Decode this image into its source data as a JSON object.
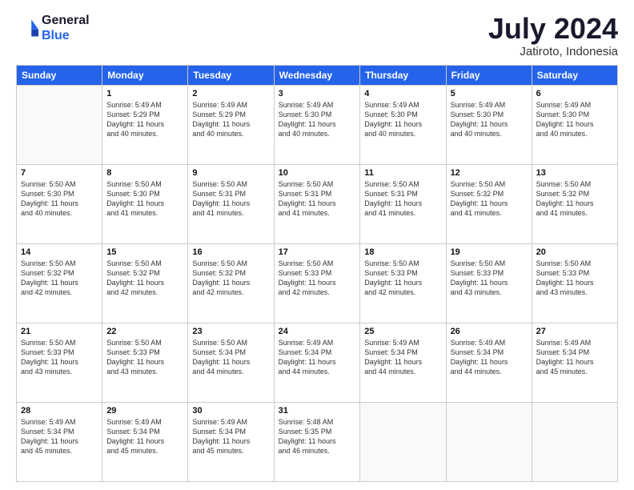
{
  "logo": {
    "text_general": "General",
    "text_blue": "Blue"
  },
  "title": "July 2024",
  "subtitle": "Jatiroto, Indonesia",
  "header_days": [
    "Sunday",
    "Monday",
    "Tuesday",
    "Wednesday",
    "Thursday",
    "Friday",
    "Saturday"
  ],
  "weeks": [
    [
      {
        "day": "",
        "info": ""
      },
      {
        "day": "1",
        "info": "Sunrise: 5:49 AM\nSunset: 5:29 PM\nDaylight: 11 hours\nand 40 minutes."
      },
      {
        "day": "2",
        "info": "Sunrise: 5:49 AM\nSunset: 5:29 PM\nDaylight: 11 hours\nand 40 minutes."
      },
      {
        "day": "3",
        "info": "Sunrise: 5:49 AM\nSunset: 5:30 PM\nDaylight: 11 hours\nand 40 minutes."
      },
      {
        "day": "4",
        "info": "Sunrise: 5:49 AM\nSunset: 5:30 PM\nDaylight: 11 hours\nand 40 minutes."
      },
      {
        "day": "5",
        "info": "Sunrise: 5:49 AM\nSunset: 5:30 PM\nDaylight: 11 hours\nand 40 minutes."
      },
      {
        "day": "6",
        "info": "Sunrise: 5:49 AM\nSunset: 5:30 PM\nDaylight: 11 hours\nand 40 minutes."
      }
    ],
    [
      {
        "day": "7",
        "info": "Sunrise: 5:50 AM\nSunset: 5:30 PM\nDaylight: 11 hours\nand 40 minutes."
      },
      {
        "day": "8",
        "info": "Sunrise: 5:50 AM\nSunset: 5:30 PM\nDaylight: 11 hours\nand 41 minutes."
      },
      {
        "day": "9",
        "info": "Sunrise: 5:50 AM\nSunset: 5:31 PM\nDaylight: 11 hours\nand 41 minutes."
      },
      {
        "day": "10",
        "info": "Sunrise: 5:50 AM\nSunset: 5:31 PM\nDaylight: 11 hours\nand 41 minutes."
      },
      {
        "day": "11",
        "info": "Sunrise: 5:50 AM\nSunset: 5:31 PM\nDaylight: 11 hours\nand 41 minutes."
      },
      {
        "day": "12",
        "info": "Sunrise: 5:50 AM\nSunset: 5:32 PM\nDaylight: 11 hours\nand 41 minutes."
      },
      {
        "day": "13",
        "info": "Sunrise: 5:50 AM\nSunset: 5:32 PM\nDaylight: 11 hours\nand 41 minutes."
      }
    ],
    [
      {
        "day": "14",
        "info": "Sunrise: 5:50 AM\nSunset: 5:32 PM\nDaylight: 11 hours\nand 42 minutes."
      },
      {
        "day": "15",
        "info": "Sunrise: 5:50 AM\nSunset: 5:32 PM\nDaylight: 11 hours\nand 42 minutes."
      },
      {
        "day": "16",
        "info": "Sunrise: 5:50 AM\nSunset: 5:32 PM\nDaylight: 11 hours\nand 42 minutes."
      },
      {
        "day": "17",
        "info": "Sunrise: 5:50 AM\nSunset: 5:33 PM\nDaylight: 11 hours\nand 42 minutes."
      },
      {
        "day": "18",
        "info": "Sunrise: 5:50 AM\nSunset: 5:33 PM\nDaylight: 11 hours\nand 42 minutes."
      },
      {
        "day": "19",
        "info": "Sunrise: 5:50 AM\nSunset: 5:33 PM\nDaylight: 11 hours\nand 43 minutes."
      },
      {
        "day": "20",
        "info": "Sunrise: 5:50 AM\nSunset: 5:33 PM\nDaylight: 11 hours\nand 43 minutes."
      }
    ],
    [
      {
        "day": "21",
        "info": "Sunrise: 5:50 AM\nSunset: 5:33 PM\nDaylight: 11 hours\nand 43 minutes."
      },
      {
        "day": "22",
        "info": "Sunrise: 5:50 AM\nSunset: 5:33 PM\nDaylight: 11 hours\nand 43 minutes."
      },
      {
        "day": "23",
        "info": "Sunrise: 5:50 AM\nSunset: 5:34 PM\nDaylight: 11 hours\nand 44 minutes."
      },
      {
        "day": "24",
        "info": "Sunrise: 5:49 AM\nSunset: 5:34 PM\nDaylight: 11 hours\nand 44 minutes."
      },
      {
        "day": "25",
        "info": "Sunrise: 5:49 AM\nSunset: 5:34 PM\nDaylight: 11 hours\nand 44 minutes."
      },
      {
        "day": "26",
        "info": "Sunrise: 5:49 AM\nSunset: 5:34 PM\nDaylight: 11 hours\nand 44 minutes."
      },
      {
        "day": "27",
        "info": "Sunrise: 5:49 AM\nSunset: 5:34 PM\nDaylight: 11 hours\nand 45 minutes."
      }
    ],
    [
      {
        "day": "28",
        "info": "Sunrise: 5:49 AM\nSunset: 5:34 PM\nDaylight: 11 hours\nand 45 minutes."
      },
      {
        "day": "29",
        "info": "Sunrise: 5:49 AM\nSunset: 5:34 PM\nDaylight: 11 hours\nand 45 minutes."
      },
      {
        "day": "30",
        "info": "Sunrise: 5:49 AM\nSunset: 5:34 PM\nDaylight: 11 hours\nand 45 minutes."
      },
      {
        "day": "31",
        "info": "Sunrise: 5:48 AM\nSunset: 5:35 PM\nDaylight: 11 hours\nand 46 minutes."
      },
      {
        "day": "",
        "info": ""
      },
      {
        "day": "",
        "info": ""
      },
      {
        "day": "",
        "info": ""
      }
    ]
  ]
}
